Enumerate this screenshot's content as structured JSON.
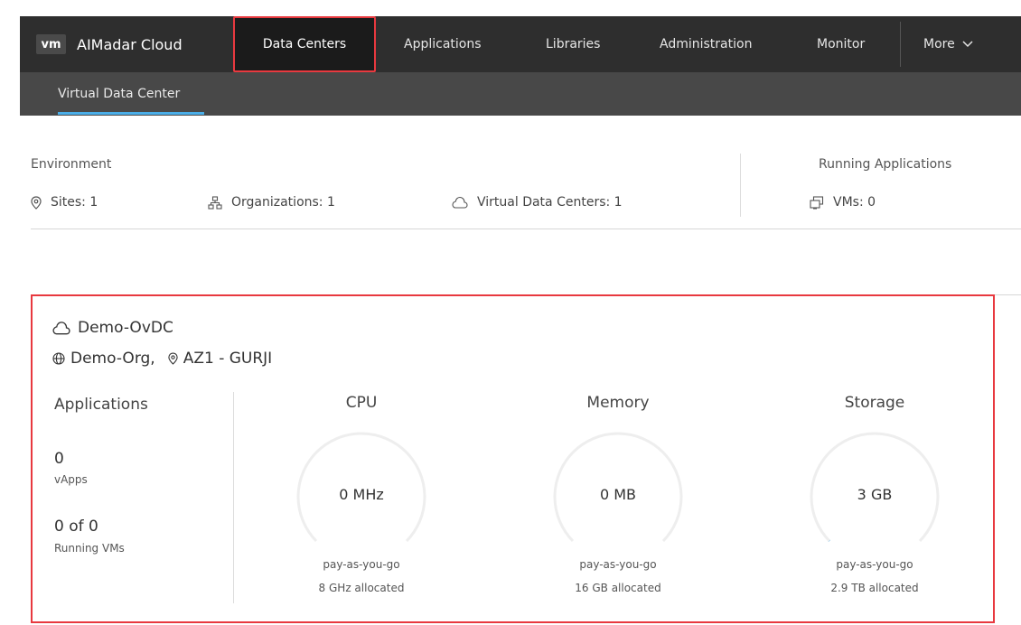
{
  "app": {
    "logo_text": "vm",
    "name": "AIMadar Cloud"
  },
  "nav": {
    "items": [
      "Data Centers",
      "Applications",
      "Libraries",
      "Administration",
      "Monitor",
      "More"
    ],
    "more_chevron": "chevron-down-icon"
  },
  "subnav": {
    "items": [
      "Virtual Data Center"
    ]
  },
  "environment": {
    "title": "Environment",
    "sites": "Sites: 1",
    "organizations": "Organizations: 1",
    "vdcs": "Virtual Data Centers: 1",
    "running_title": "Running Applications",
    "vms": "VMs: 0"
  },
  "vdc": {
    "name": "Demo-OvDC",
    "org": "Demo-Org,",
    "site": "AZ1 - GURJI",
    "applications": {
      "title": "Applications",
      "vapps_count": "0",
      "vapps_label": "vApps",
      "running_count": "0 of 0",
      "running_label": "Running VMs"
    },
    "metrics": [
      {
        "title": "CPU",
        "value": "0 MHz",
        "model": "pay-as-you-go",
        "allocated": "8 GHz allocated",
        "used_fraction": 0
      },
      {
        "title": "Memory",
        "value": "0 MB",
        "model": "pay-as-you-go",
        "allocated": "16 GB allocated",
        "used_fraction": 0
      },
      {
        "title": "Storage",
        "value": "3 GB",
        "model": "pay-as-you-go",
        "allocated": "2.9 TB allocated",
        "used_fraction": 0.001
      }
    ]
  },
  "colors": {
    "accent": "#4aaee8",
    "highlight": "#e8393f",
    "nav_bg": "#2e2e2e",
    "subnav_bg": "#484848",
    "gauge_track": "#eeeeee"
  }
}
